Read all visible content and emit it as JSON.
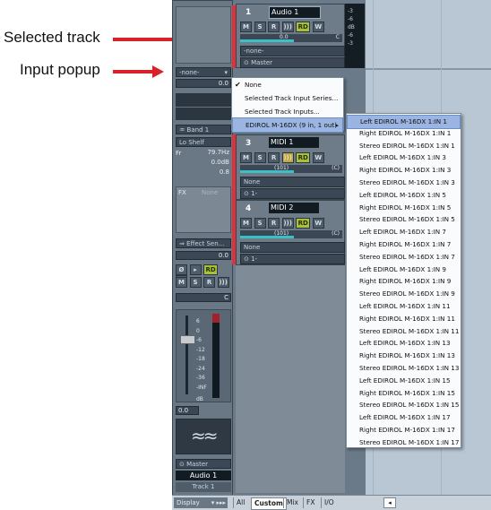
{
  "callouts": {
    "selected_track": "Selected track",
    "input_popup": "Input popup"
  },
  "colors": {
    "arrow": "#d8222a",
    "track_selected_stripe": "#e0303a",
    "highlight": "#9ab5e1",
    "record_ready": "#a9c13a"
  },
  "inspector": {
    "input_value": "-none-",
    "gain_value": "0.0",
    "band": "Band 1",
    "filter_type": "Lo Shelf",
    "fr_label": "Fr",
    "fr_value": "79.7Hz",
    "gain2_value": "0.0dB",
    "q_value": "0.8",
    "fx_label": "FX",
    "fx_value": "None",
    "effect_send": "Effect Sen...",
    "send_value": "0.0",
    "pan_label": "C",
    "fader_scale": [
      "6",
      "0",
      "-6",
      "-12",
      "-18",
      "-24",
      "-36",
      "-INF"
    ],
    "db_label": "dB",
    "fader_value": "0.0",
    "output": "Master",
    "track_name": "Audio 1",
    "track_label": "Track 1",
    "display_label": "Display",
    "buttons": {
      "mute": "M",
      "solo": "S",
      "read": "R",
      "rd": "RD",
      "w": "W",
      "ioff": "Ø"
    }
  },
  "tracks": [
    {
      "number": "1",
      "name": "Audio 1",
      "volume": "0.0",
      "pan": "C",
      "input": "-none-",
      "output": "Master"
    },
    {
      "number": "3",
      "name": "MIDI 1",
      "volume": "(101)",
      "pan": "(C)",
      "input": "None",
      "output": "1-"
    },
    {
      "number": "4",
      "name": "MIDI 2",
      "volume": "(101)",
      "pan": "(C)",
      "input": "None",
      "output": "1-"
    }
  ],
  "track_buttons": {
    "mute": "M",
    "solo": "S",
    "read": "R",
    "rd": "RD",
    "w": "W"
  },
  "meter_scale": [
    "-3",
    "-6",
    "dB",
    "-6",
    "-3"
  ],
  "context_menu": {
    "items": [
      "None",
      "Selected Track Input Series...",
      "Selected Track Inputs...",
      "EDIROL M-16DX (9 in, 1 out)"
    ],
    "checked_index": 0
  },
  "submenu": {
    "items": [
      "Left EDIROL M-16DX 1:IN 1",
      "Right EDIROL M-16DX 1:IN 1",
      "Stereo EDIROL M-16DX 1:IN 1",
      "Left EDIROL M-16DX 1:IN 3",
      "Right EDIROL M-16DX 1:IN 3",
      "Stereo EDIROL M-16DX 1:IN 3",
      "Left EDIROL M-16DX 1:IN 5",
      "Right EDIROL M-16DX 1:IN 5",
      "Stereo EDIROL M-16DX 1:IN 5",
      "Left EDIROL M-16DX 1:IN 7",
      "Right EDIROL M-16DX 1:IN 7",
      "Stereo EDIROL M-16DX 1:IN 7",
      "Left EDIROL M-16DX 1:IN 9",
      "Right EDIROL M-16DX 1:IN 9",
      "Stereo EDIROL M-16DX 1:IN 9",
      "Left EDIROL M-16DX 1:IN 11",
      "Right EDIROL M-16DX 1:IN 11",
      "Stereo EDIROL M-16DX 1:IN 11",
      "Left EDIROL M-16DX 1:IN 13",
      "Right EDIROL M-16DX 1:IN 13",
      "Stereo EDIROL M-16DX 1:IN 13",
      "Left EDIROL M-16DX 1:IN 15",
      "Right EDIROL M-16DX 1:IN 15",
      "Stereo EDIROL M-16DX 1:IN 15",
      "Left EDIROL M-16DX 1:IN 17",
      "Right EDIROL M-16DX 1:IN 17",
      "Stereo EDIROL M-16DX 1:IN 17"
    ],
    "highlighted_index": 0
  },
  "bottom_tabs": {
    "all": "All",
    "custom": "Custom",
    "mix": "Mix",
    "fx": "FX",
    "io": "I/O"
  }
}
